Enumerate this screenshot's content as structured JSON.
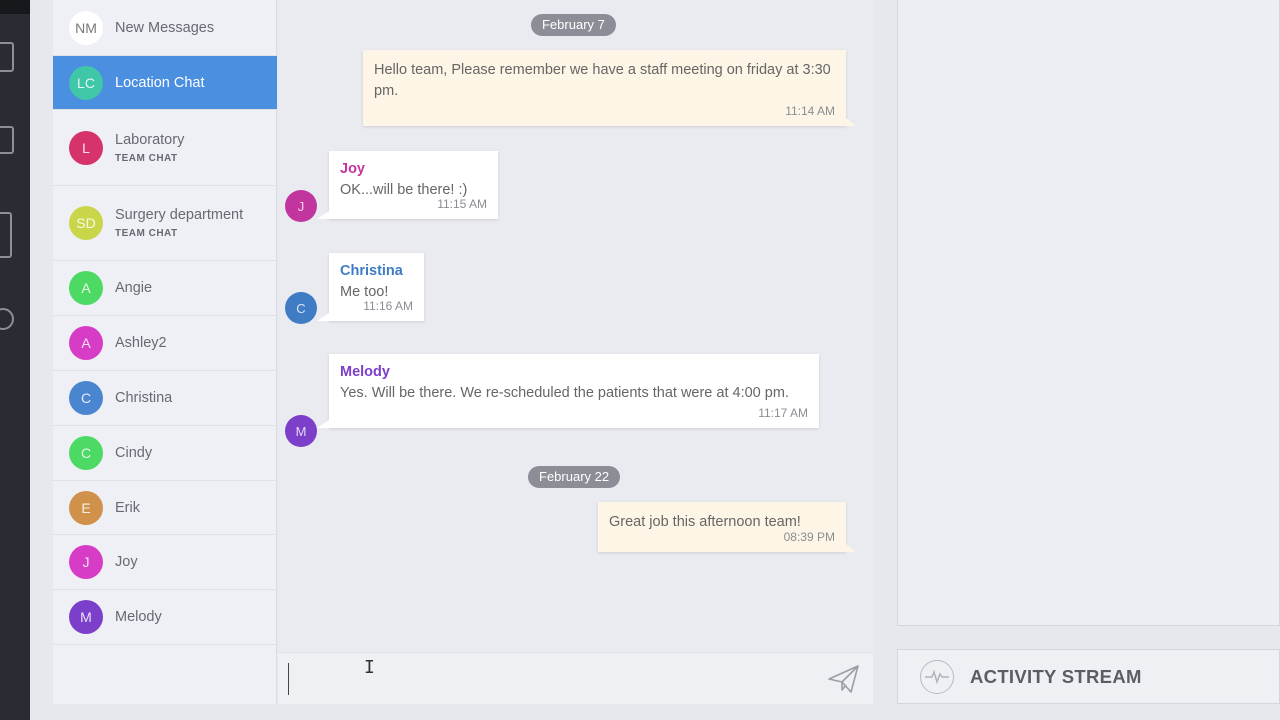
{
  "contacts": [
    {
      "initials": "NM",
      "name": "New Messages",
      "sub": "",
      "color": "#ffffff",
      "textColor": "#777",
      "active": false
    },
    {
      "initials": "LC",
      "name": "Location Chat",
      "sub": "",
      "color": "#3fc7a8",
      "active": true
    },
    {
      "initials": "L",
      "name": "Laboratory",
      "sub": "TEAM CHAT",
      "color": "#d6336c",
      "active": false
    },
    {
      "initials": "SD",
      "name": "Surgery department",
      "sub": "TEAM CHAT",
      "color": "#c9d64a",
      "active": false
    },
    {
      "initials": "A",
      "name": "Angie",
      "sub": "",
      "color": "#4cd964",
      "active": false
    },
    {
      "initials": "A",
      "name": "Ashley2",
      "sub": "",
      "color": "#d63cc5",
      "active": false
    },
    {
      "initials": "C",
      "name": "Christina",
      "sub": "",
      "color": "#4a86d0",
      "active": false
    },
    {
      "initials": "C",
      "name": "Cindy",
      "sub": "",
      "color": "#4cd964",
      "active": false
    },
    {
      "initials": "E",
      "name": "Erik",
      "sub": "",
      "color": "#d0924a",
      "active": false
    },
    {
      "initials": "J",
      "name": "Joy",
      "sub": "",
      "color": "#d63cc5",
      "active": false
    },
    {
      "initials": "M",
      "name": "Melody",
      "sub": "",
      "color": "#7b3fc9",
      "active": false
    }
  ],
  "chat": {
    "date1": "February 7",
    "date2": "February 22",
    "messages": [
      {
        "text": "Hello team, Please remember we have a staff meeting on friday at 3:30 pm.",
        "time": "11:14 AM"
      },
      {
        "sender": "Joy",
        "initials": "J",
        "text": "OK...will be there! :)",
        "time": "11:15 AM"
      },
      {
        "sender": "Christina",
        "initials": "C",
        "text": "Me too!",
        "time": "11:16 AM"
      },
      {
        "sender": "Melody",
        "initials": "M",
        "text": "Yes. Will be there. We re-scheduled the patients that were at 4:00 pm.",
        "time": "11:17 AM"
      },
      {
        "text": "Great job this afternoon team!",
        "time": "08:39 PM"
      }
    ],
    "input_value": ""
  },
  "colors": {
    "joy": "#c2359e",
    "christina": "#3f7cc4",
    "melody": "#7b3fc9",
    "active": "#4a8fe0"
  },
  "activity": {
    "label": "ACTIVITY STREAM"
  },
  "icons": {
    "send": "paper-plane-icon",
    "activity": "pulse-icon"
  }
}
